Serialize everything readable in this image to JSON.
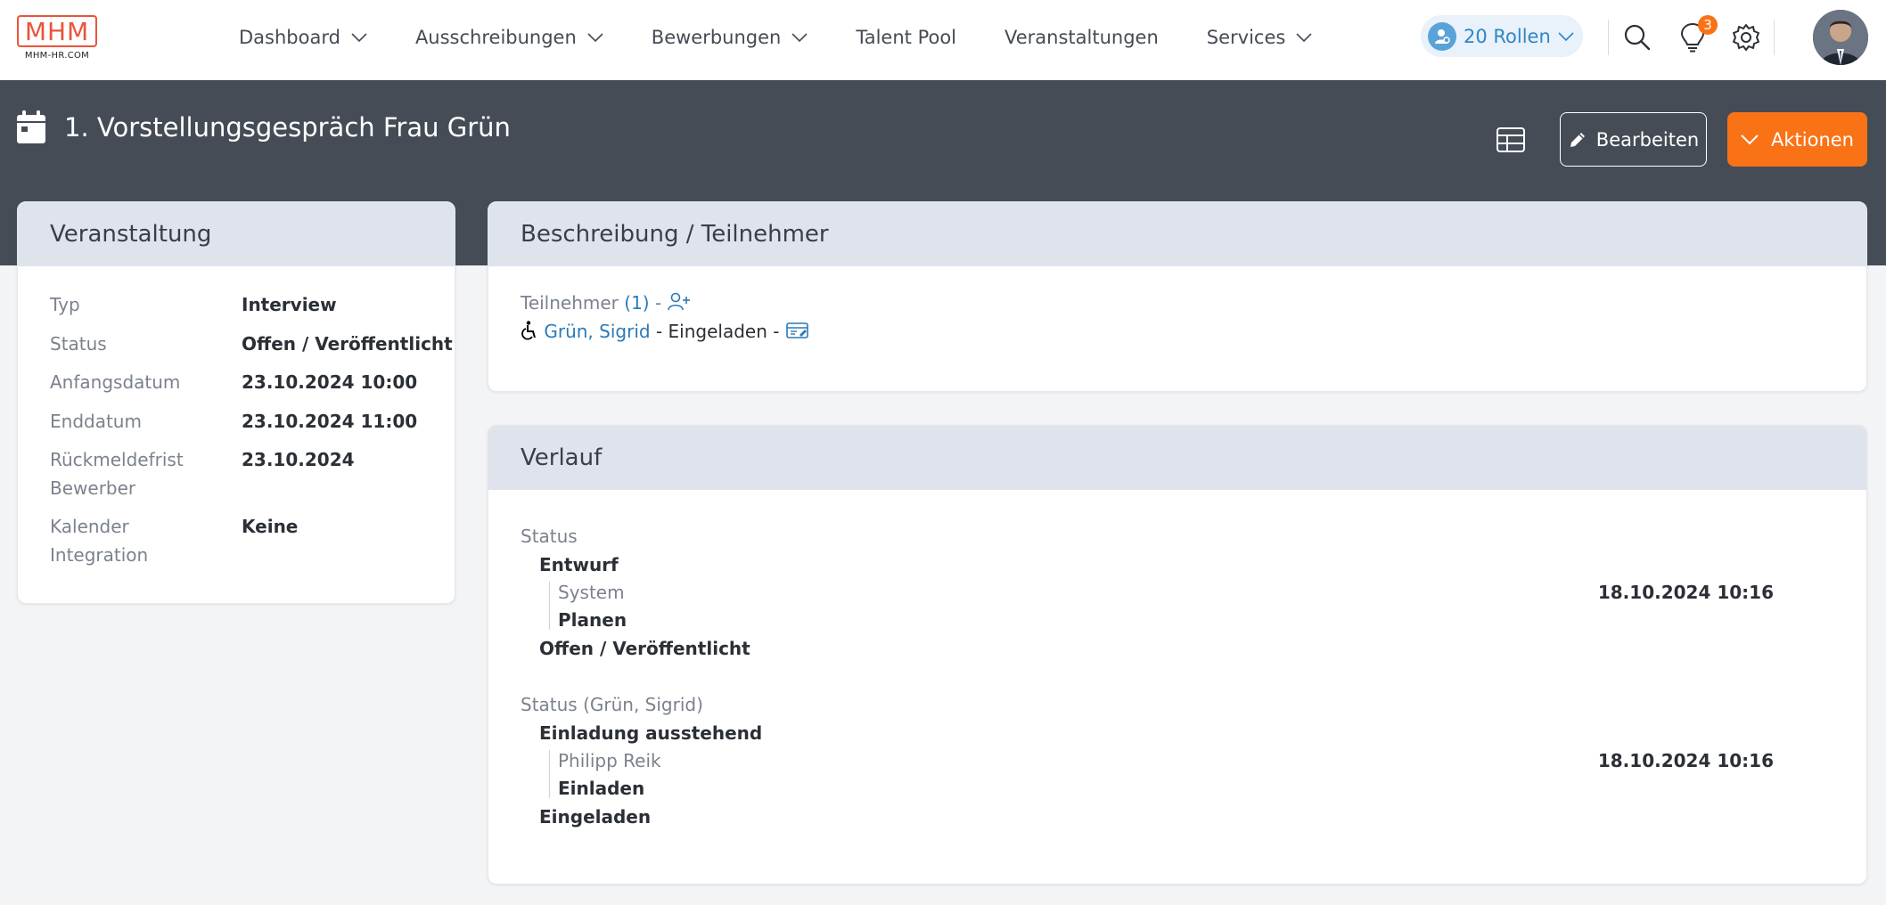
{
  "logo": {
    "mark": "MHM",
    "sub": "MHM-HR.COM"
  },
  "nav": {
    "items": [
      {
        "label": "Dashboard",
        "has_dropdown": true
      },
      {
        "label": "Ausschreibungen",
        "has_dropdown": true
      },
      {
        "label": "Bewerbungen",
        "has_dropdown": true
      },
      {
        "label": "Talent Pool",
        "has_dropdown": false
      },
      {
        "label": "Veranstaltungen",
        "has_dropdown": false
      },
      {
        "label": "Services",
        "has_dropdown": true
      }
    ],
    "roles_label": "20 Rollen",
    "notification_count": "3",
    "icons": [
      "search-icon",
      "lightbulb-icon",
      "gear-icon"
    ]
  },
  "header": {
    "title": "1. Vorstellungsgespräch Frau Grün",
    "edit_label": "Bearbeiten",
    "actions_label": "Aktionen"
  },
  "event": {
    "heading": "Veranstaltung",
    "fields": [
      {
        "label": "Typ",
        "value": "Interview"
      },
      {
        "label": "Status",
        "value": "Offen / Veröffentlicht"
      },
      {
        "label": "Anfangsdatum",
        "value": "23.10.2024 10:00"
      },
      {
        "label": "Enddatum",
        "value": "23.10.2024 11:00"
      },
      {
        "label_line1": "Rückmeldefrist",
        "label_line2": "Bewerber",
        "value": "23.10.2024"
      },
      {
        "label_line1": "Kalender",
        "label_line2": "Integration",
        "value": "Keine"
      }
    ]
  },
  "description": {
    "heading": "Beschreibung / Teilnehmer",
    "participants_label": "Teilnehmer",
    "participants_count": "(1)",
    "separator": "-",
    "participant": {
      "name": "Grün, Sigrid",
      "status": "- Eingeladen -"
    }
  },
  "history": {
    "heading": "Verlauf",
    "groups": [
      {
        "title": "Status",
        "from": "Entwurf",
        "actor": "System",
        "action": "Planen",
        "to": "Offen / Veröffentlicht",
        "datetime": "18.10.2024 10:16"
      },
      {
        "title": "Status (Grün, Sigrid)",
        "from": "Einladung ausstehend",
        "actor": "Philipp Reik",
        "action": "Einladen",
        "to": "Eingeladen",
        "datetime": "18.10.2024 10:16"
      }
    ]
  },
  "colors": {
    "accent": "#f97316",
    "band": "#454c56",
    "link": "#2a7ab8",
    "card_head": "#dfe3ec"
  }
}
